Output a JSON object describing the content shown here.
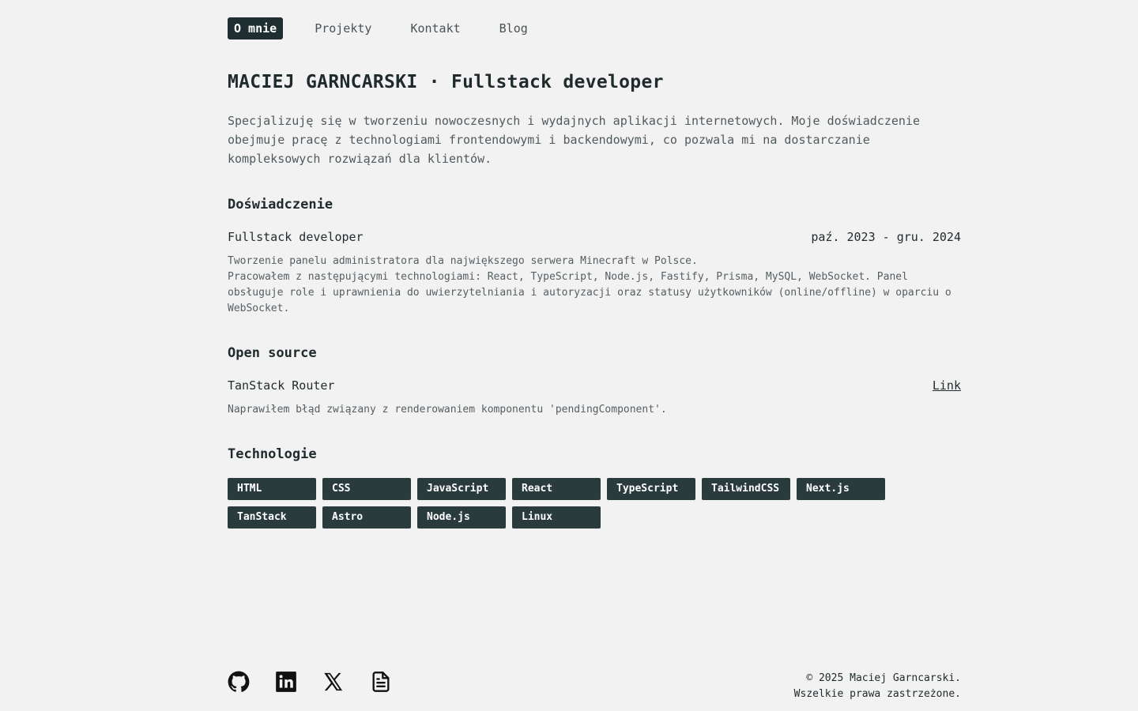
{
  "nav": {
    "items": [
      {
        "label": "O mnie",
        "active": true
      },
      {
        "label": "Projekty",
        "active": false
      },
      {
        "label": "Kontakt",
        "active": false
      },
      {
        "label": "Blog",
        "active": false
      }
    ]
  },
  "header": {
    "title": "MACIEJ GARNCARSKI · Fullstack developer"
  },
  "intro": "Specjalizuję się w tworzeniu nowoczesnych i wydajnych aplikacji internetowych. Moje doświadczenie obejmuje pracę z technologiami frontendowymi i backendowymi, co pozwala mi na dostarczanie kompleksowych rozwiązań dla klientów.",
  "experience": {
    "title": "Doświadczenie",
    "role": "Fullstack developer",
    "period": "paź. 2023 - gru. 2024",
    "line1": "Tworzenie panelu administratora dla największego serwera Minecraft w Polsce.",
    "line2": "Pracowałem z następującymi technologiami: React, TypeScript, Node.js, Fastify, Prisma, MySQL, WebSocket. Panel obsługuje role i uprawnienia do uwierzytelniania i autoryzacji oraz statusy użytkowników (online/offline) w oparciu o WebSocket."
  },
  "opensource": {
    "title": "Open source",
    "project": "TanStack Router",
    "link_label": "Link",
    "description": "Naprawiłem błąd związany z renderowaniem komponentu 'pendingComponent'."
  },
  "technologies": {
    "title": "Technologie",
    "tags": [
      "HTML",
      "CSS",
      "JavaScript",
      "React",
      "TypeScript",
      "TailwindCSS",
      "Next.js",
      "TanStack",
      "Astro",
      "Node.js",
      "Linux"
    ]
  },
  "footer": {
    "icons": [
      "github-icon",
      "linkedin-icon",
      "x-icon",
      "document-icon"
    ],
    "copyright_line1": "© 2025 Maciej Garncarski.",
    "copyright_line2": "Wszelkie prawa zastrzeżone."
  },
  "colors": {
    "background": "#f2f2f2",
    "accent_dark": "#1f2e31",
    "tag_bg": "#2a3b3e",
    "text": "#1f2a2c"
  }
}
